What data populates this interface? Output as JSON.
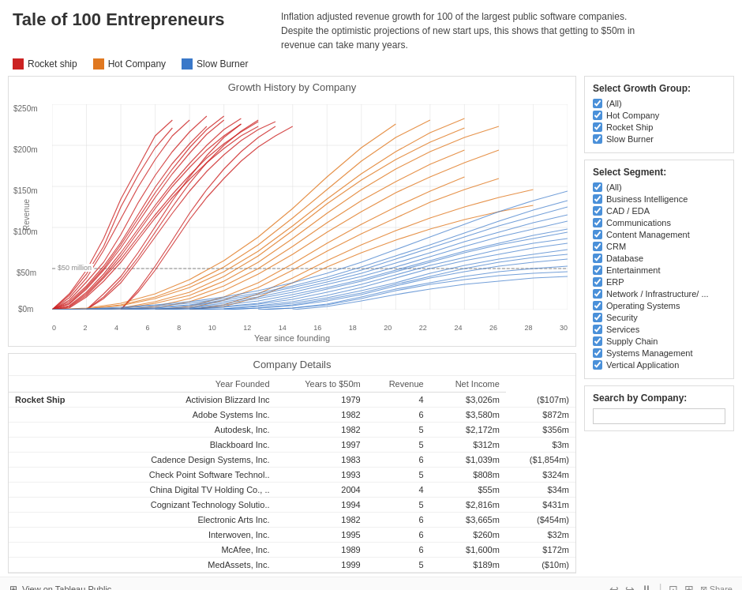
{
  "header": {
    "title": "Tale of 100 Entrepreneurs",
    "description": "Inflation adjusted revenue growth for 100 of the largest public software companies. Despite the optimistic projections of new start ups, this shows that getting to $50m in revenue can take many years."
  },
  "legend": [
    {
      "label": "Rocket ship",
      "color": "#cc2222"
    },
    {
      "label": "Hot Company",
      "color": "#e07820"
    },
    {
      "label": "Slow Burner",
      "color": "#3a78c9"
    }
  ],
  "chart": {
    "title": "Growth History by Company",
    "yLabels": [
      "$250m",
      "$200m",
      "$150m",
      "$100m",
      "$50m",
      "$0m"
    ],
    "xLabels": [
      "0",
      "2",
      "4",
      "6",
      "8",
      "10",
      "12",
      "14",
      "16",
      "18",
      "20",
      "22",
      "24",
      "26",
      "28",
      "30"
    ],
    "xTitle": "Year since founding",
    "yTitle": "Revenue",
    "annotation50m": "$50 million"
  },
  "table": {
    "title": "Company Details",
    "columns": [
      "",
      "Year Founded",
      "Years to $50m",
      "Revenue",
      "Net Income"
    ],
    "groups": [
      {
        "label": "Rocket Ship",
        "rows": [
          {
            "company": "Activision Blizzard Inc",
            "yearFounded": "1979",
            "yearsTo50m": "4",
            "revenue": "$3,026m",
            "netIncome": "($107m)"
          },
          {
            "company": "Adobe Systems Inc.",
            "yearFounded": "1982",
            "yearsTo50m": "6",
            "revenue": "$3,580m",
            "netIncome": "$872m"
          },
          {
            "company": "Autodesk, Inc.",
            "yearFounded": "1982",
            "yearsTo50m": "5",
            "revenue": "$2,172m",
            "netIncome": "$356m"
          },
          {
            "company": "Blackboard Inc.",
            "yearFounded": "1997",
            "yearsTo50m": "5",
            "revenue": "$312m",
            "netIncome": "$3m"
          },
          {
            "company": "Cadence Design Systems, Inc.",
            "yearFounded": "1983",
            "yearsTo50m": "6",
            "revenue": "$1,039m",
            "netIncome": "($1,854m)"
          },
          {
            "company": "Check Point Software Technol..",
            "yearFounded": "1993",
            "yearsTo50m": "5",
            "revenue": "$808m",
            "netIncome": "$324m"
          },
          {
            "company": "China Digital TV Holding Co., ..",
            "yearFounded": "2004",
            "yearsTo50m": "4",
            "revenue": "$55m",
            "netIncome": "$34m"
          },
          {
            "company": "Cognizant Technology Solutio..",
            "yearFounded": "1994",
            "yearsTo50m": "5",
            "revenue": "$2,816m",
            "netIncome": "$431m"
          },
          {
            "company": "Electronic Arts Inc.",
            "yearFounded": "1982",
            "yearsTo50m": "6",
            "revenue": "$3,665m",
            "netIncome": "($454m)"
          },
          {
            "company": "Interwoven, Inc.",
            "yearFounded": "1995",
            "yearsTo50m": "6",
            "revenue": "$260m",
            "netIncome": "$32m"
          },
          {
            "company": "McAfee, Inc.",
            "yearFounded": "1989",
            "yearsTo50m": "6",
            "revenue": "$1,600m",
            "netIncome": "$172m"
          },
          {
            "company": "MedAssets, Inc.",
            "yearFounded": "1999",
            "yearsTo50m": "5",
            "revenue": "$189m",
            "netIncome": "($10m)"
          }
        ]
      }
    ]
  },
  "filters": {
    "growthGroup": {
      "title": "Select Growth Group:",
      "items": [
        {
          "label": "(All)",
          "checked": true
        },
        {
          "label": "Hot Company",
          "checked": true
        },
        {
          "label": "Rocket Ship",
          "checked": true
        },
        {
          "label": "Slow Burner",
          "checked": true
        }
      ]
    },
    "segment": {
      "title": "Select Segment:",
      "items": [
        {
          "label": "(All)",
          "checked": true
        },
        {
          "label": "Business Intelligence",
          "checked": true
        },
        {
          "label": "CAD / EDA",
          "checked": true
        },
        {
          "label": "Communications",
          "checked": true
        },
        {
          "label": "Content Management",
          "checked": true
        },
        {
          "label": "CRM",
          "checked": true
        },
        {
          "label": "Database",
          "checked": true
        },
        {
          "label": "Entertainment",
          "checked": true
        },
        {
          "label": "ERP",
          "checked": true
        },
        {
          "label": "Network / Infrastructure/ ...",
          "checked": true
        },
        {
          "label": "Operating Systems",
          "checked": true
        },
        {
          "label": "Security",
          "checked": true
        },
        {
          "label": "Services",
          "checked": true
        },
        {
          "label": "Supply Chain",
          "checked": true
        },
        {
          "label": "Systems Management",
          "checked": true
        },
        {
          "label": "Vertical Application",
          "checked": true
        }
      ]
    },
    "search": {
      "title": "Search by Company:",
      "placeholder": ""
    }
  },
  "footer": {
    "tableauLabel": "View on Tableau Public",
    "buttons": [
      "⟲",
      "⟳",
      "↩",
      "↪",
      "|",
      "⊞",
      "⊟",
      "⊠"
    ]
  }
}
